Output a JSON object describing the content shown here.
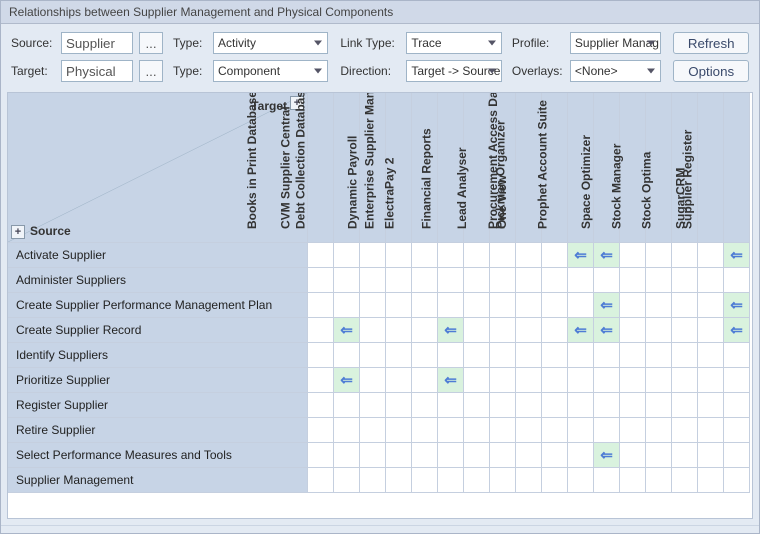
{
  "title": "Relationships between Supplier Management and Physical Components",
  "labels": {
    "source": "Source:",
    "target": "Target:",
    "type": "Type:",
    "link_type": "Link Type:",
    "direction": "Direction:",
    "profile": "Profile:",
    "overlays": "Overlays:",
    "target_axis": "Target",
    "source_axis": "Source"
  },
  "toolbar": {
    "source_value": "Supplier",
    "target_value": "Physical",
    "browse": "...",
    "type_source": "Activity",
    "type_target": "Component",
    "link_type": "Trace",
    "direction": "Target -> Source",
    "profile": "Supplier Manag…",
    "overlays": "<None>",
    "refresh": "Refresh",
    "options": "Options",
    "plus": "+"
  },
  "columns": [
    "Books in Print Database",
    "CVM Supplier Central",
    "Debt Collection Database",
    "Dynamic Payroll",
    "ElectraPay 2",
    "Enterprise Supplier Manager",
    "Financial Reports",
    "Lead Analyser",
    "One View",
    "Pickman Organizer",
    "Procurement Access Database",
    "Prophet Account Suite",
    "Space Optimizer",
    "Stock Manager",
    "Stock Optima",
    "SugarCRM",
    "Supplier Register"
  ],
  "rows": [
    "Activate Supplier",
    "Administer Suppliers",
    "Create Supplier Performance Management Plan",
    "Create Supplier Record",
    "Identify Suppliers",
    "Prioritize Supplier",
    "Register Supplier",
    "Retire Supplier",
    "Select Performance Measures and Tools",
    "Supplier Management"
  ],
  "relationships": [
    {
      "row": "Activate Supplier",
      "cols": [
        "Procurement Access Database",
        "Prophet Account Suite",
        "Supplier Register"
      ]
    },
    {
      "row": "Create Supplier Performance Management Plan",
      "cols": [
        "Prophet Account Suite",
        "Supplier Register"
      ]
    },
    {
      "row": "Create Supplier Record",
      "cols": [
        "CVM Supplier Central",
        "Enterprise Supplier Manager",
        "Procurement Access Database",
        "Prophet Account Suite",
        "Supplier Register"
      ]
    },
    {
      "row": "Prioritize Supplier",
      "cols": [
        "CVM Supplier Central",
        "Enterprise Supplier Manager"
      ]
    },
    {
      "row": "Select Performance Measures and Tools",
      "cols": [
        "Prophet Account Suite"
      ]
    }
  ],
  "arrow_glyph": "⇐"
}
